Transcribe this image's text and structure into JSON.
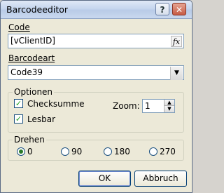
{
  "window": {
    "title": "Barcodeeditor"
  },
  "titlebar_buttons": {
    "help": "?",
    "close": "✕"
  },
  "code": {
    "label": "Code",
    "value": "[vClientID]",
    "fx": "fx"
  },
  "barcodeart": {
    "label": "Barcodeart",
    "selected": "Code39"
  },
  "optionen": {
    "title": "Optionen",
    "checksumme": {
      "label": "Checksumme",
      "checked": true
    },
    "lesbar": {
      "label": "Lesbar",
      "checked": true
    },
    "zoom": {
      "label": "Zoom:",
      "value": "1"
    }
  },
  "drehen": {
    "title": "Drehen",
    "options": [
      "0",
      "90",
      "180",
      "270"
    ],
    "selected": "0"
  },
  "buttons": {
    "ok": "OK",
    "abbruch": "Abbruch"
  }
}
